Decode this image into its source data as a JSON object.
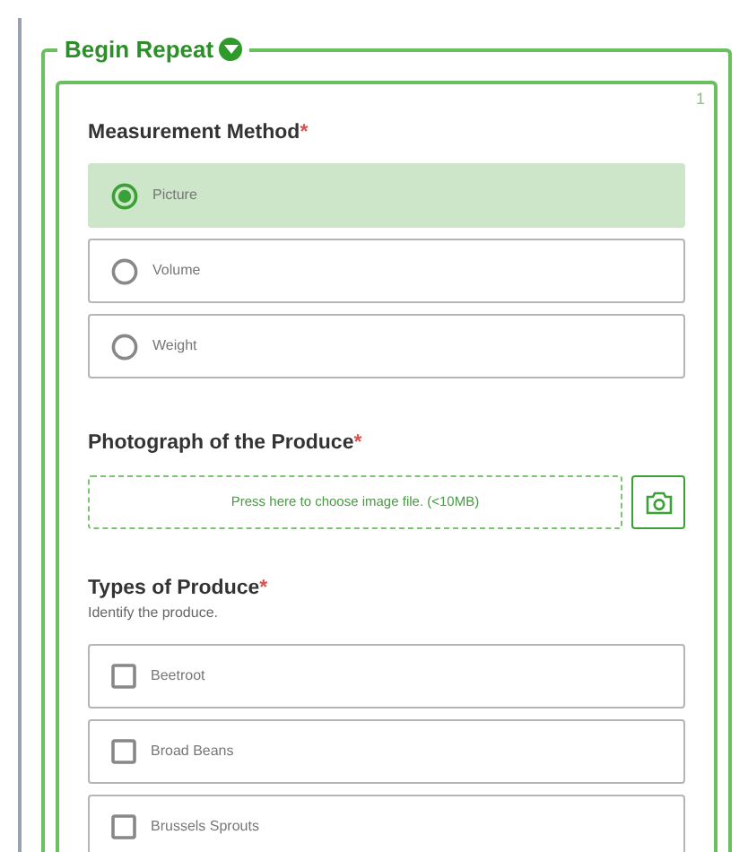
{
  "group": {
    "title": "Begin Repeat",
    "expanded": true,
    "index": "1"
  },
  "questions": [
    {
      "kind": "radio",
      "label": "Measurement Method",
      "required_mark": "*",
      "options": [
        {
          "label": "Picture",
          "selected": true
        },
        {
          "label": "Volume",
          "selected": false
        },
        {
          "label": "Weight",
          "selected": false
        }
      ]
    },
    {
      "kind": "file",
      "label": "Photograph of the Produce",
      "required_mark": "*",
      "placeholder": "Press here to choose image file. (<10MB)"
    },
    {
      "kind": "checkbox",
      "label": "Types of Produce",
      "required_mark": "*",
      "hint": "Identify the produce.",
      "options": [
        {
          "label": "Beetroot",
          "checked": false
        },
        {
          "label": "Broad Beans",
          "checked": false
        },
        {
          "label": "Brussels Sprouts",
          "checked": false
        }
      ]
    }
  ]
}
